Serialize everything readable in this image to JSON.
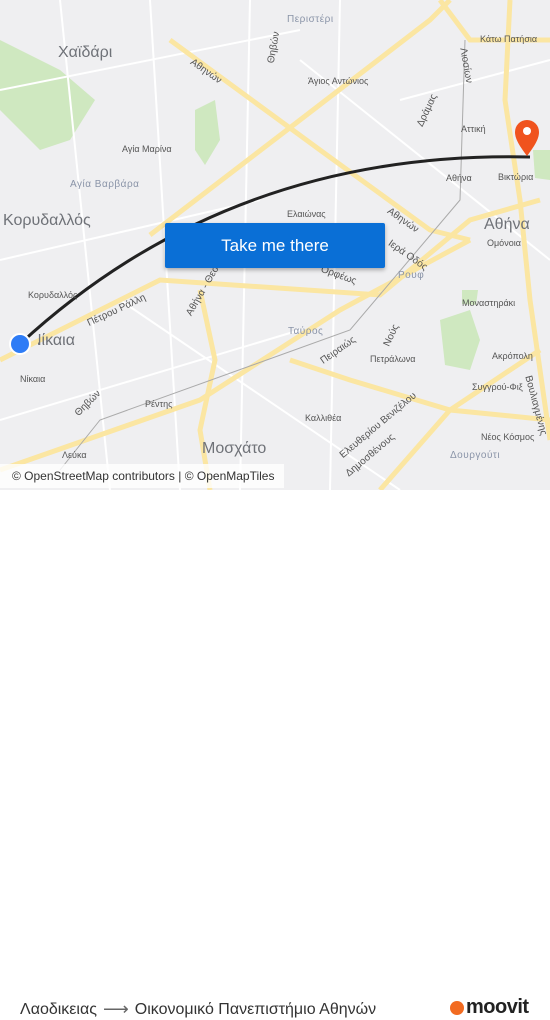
{
  "map": {
    "labels": [
      "Χαϊδάρι",
      "Περιστέρι",
      "Κάτω Πατήσια",
      "Άγιος Αντώνιος",
      "Αγία Μαρίνα",
      "Αγία Βαρβάρα",
      "Αττική",
      "Αθήνα",
      "Βικτώρια",
      "Κορυδαλλός",
      "Ελαιώνας",
      "Αθήνα",
      "Ομόνοια",
      "Ρουφ",
      "Κορυδαλλός",
      "Νίκαια",
      "Μοναστηράκι",
      "Ταύρος",
      "Πετράλωνα",
      "Ακρόπολη",
      "Νίκαια",
      "Ρέντης",
      "Καλλιθέα",
      "Συγγρού-Φιξ",
      "Μοσχάτο",
      "Νέος Κόσμος",
      "Δουργούτι",
      "Λεύκα"
    ],
    "roads": [
      "Αθηνών",
      "Θηβών",
      "Δράμας",
      "Λιοσίων",
      "Πέτρου Ράλλη",
      "Πειραιώς",
      "Ορφέως",
      "Ιερά Οδός",
      "Ελευθερίου Βενιζέλου",
      "Θηβών",
      "Αθήνα - Θεσσαλονίκη",
      "Νούς",
      "Βουλιαγμένης",
      "Δημοσθένους",
      "Αθηνών"
    ],
    "origin_color": "#2e7cf6",
    "destination_color": "#f0531e",
    "route_color": "#222222"
  },
  "cta": {
    "label": "Take me there"
  },
  "attribution": "© OpenStreetMap contributors | © OpenMapTiles",
  "footer": {
    "origin": "Λαοδικειας",
    "arrow": "⟶",
    "destination": "Οικονομικό Πανεπιστήμιο Αθηνών",
    "brand": "moovit"
  }
}
